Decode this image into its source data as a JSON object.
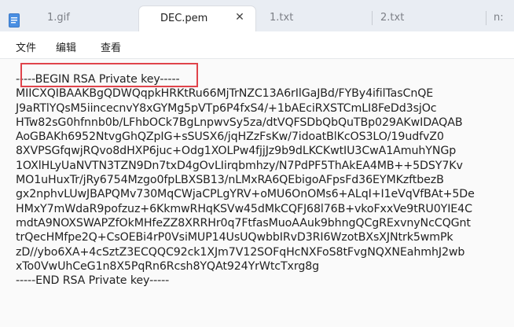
{
  "tabs": [
    {
      "label": "1.gif",
      "active": false
    },
    {
      "label": "DEC.pem",
      "active": true
    },
    {
      "label": "1.txt",
      "active": false
    },
    {
      "label": "2.txt",
      "active": false
    },
    {
      "label": "n:",
      "active": false
    }
  ],
  "close_glyph": "✕",
  "menu": [
    "文件",
    "编辑",
    "查看"
  ],
  "content_lines": [
    "-----BEGIN RSA Private key-----",
    "MIICXQIBAAKBgQDWQqpkHRKtRu66MjTrNZC13A6rIlGaJBd/FYBy4ifilTasCnQE",
    "J9aRTlYQsM5iincecnvY8xGYMg5pVTp6P4fxS4/+1bAEciRXSTCmLI8FeDd3sjOc",
    "HTw82sG0hfnnb0b/LFhbOCk7BgLnpwvSy5za/dtVQFSDbQbQuTBp029AKwIDAQAB",
    "AoGBAKh6952NtvgGhQZpIG+sSUSX6/jqHZzFsKw/7idoatBlKcOS3LO/19udfvZ0",
    "8XVPSGfqwjRQvo8dHXP6juc+Odg1XOLPw4fjjJz9b9dLKCKwtIU3CwA1AmuhYNGp",
    "1OXlHLyUaNVTN3TZN9Dn7txD4gOvLIirqbmhzy/N7PdPF5ThAkEA4MB++5DSY7Kv",
    "MO1uHuxTr/jRy6754Mzgo0fpLBXSB13/nLMxRA6QEbigoAFpsFd36EYMKzftbezB",
    "gx2nphvLUwJBAPQMv730MqCWjaCPLgYRV+oMU6OnOMs6+ALqI+I1eVqVfBAt+5De",
    "HMxY7mWdaR9pofzuz+6KkmwRHqKSVw45dMkCQFJ68l76B+vkoFxxVe9tRU0YIE4C",
    "mdtA9NOXSWAPZfOkMHfeZZ8XRRHr0q7FtfasMuoAAuk9bhngQCgRExvnyNcCQGnt",
    "trQecHMfpe2Q+CsOEBi4rP0VsiMUP14UsUQwbbIRvD3RI6WzotBXsXJNtrk5wmPk",
    "zD//ybo6XA+4cSztZ3ECQQC92ck1XJm7V12SOFqHcNXFoS8tFvgNQXNEahmhJ2wb",
    "xTo0VwUhCeG1n8X5PqRn6Rcsh8YQAt924YrWtcTxrg8g",
    "-----END RSA Private key-----"
  ],
  "colors": {
    "highlight_border": "#e0444b",
    "tab_active_bg": "#ffffff",
    "tabbar_bg": "#e9edf3"
  }
}
